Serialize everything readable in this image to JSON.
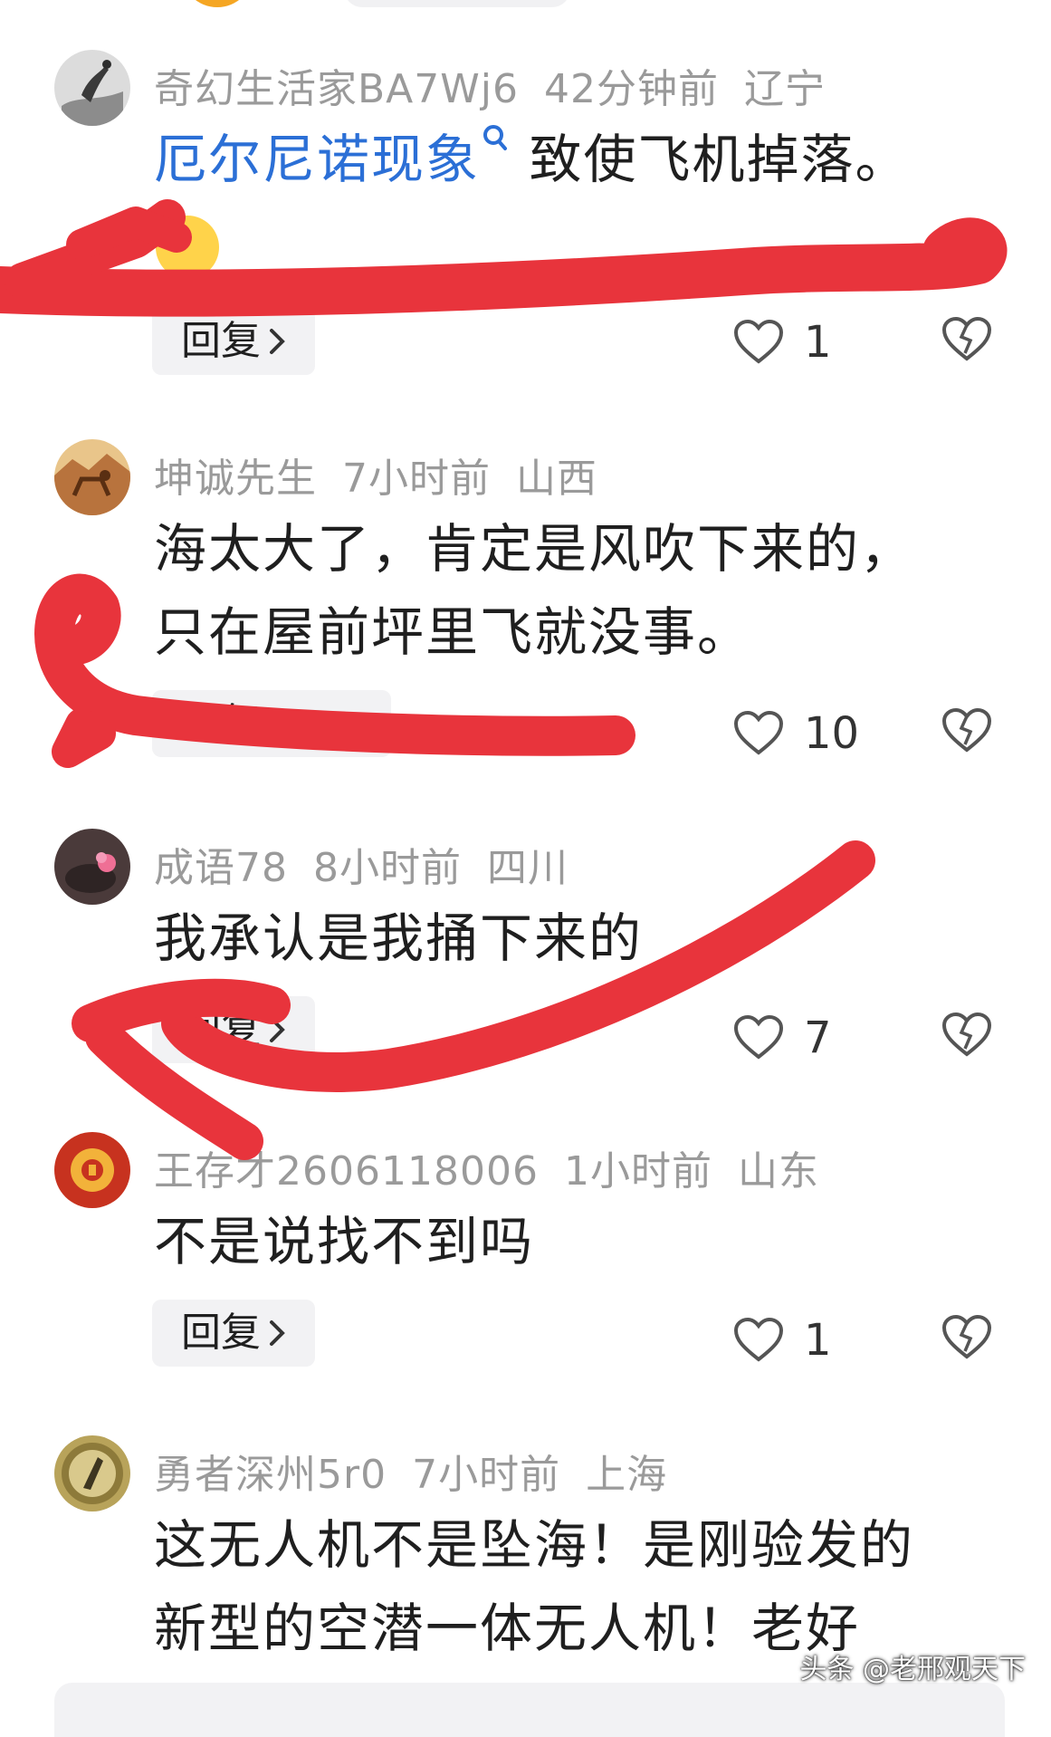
{
  "comments": [
    {
      "user": "奇幻生活家BA7Wj6",
      "time": "42分钟前",
      "location": "辽宁",
      "text_link": "厄尔尼诺现象",
      "text": "致使飞机掉落。",
      "likes": "1"
    },
    {
      "user": "坤诚先生",
      "time": "7小时前",
      "location": "山西",
      "text_line1": "海太大了，肯定是风吹下来的，",
      "text_line2": "只在屋前坪里飞就没事。",
      "likes": "10"
    },
    {
      "user": "成语78",
      "time": "8小时前",
      "location": "四川",
      "text": "我承认是我捅下来的",
      "likes": "7"
    },
    {
      "user": "王存才2606118006",
      "time": "1小时前",
      "location": "山东",
      "text": "不是说找不到吗",
      "likes": "1"
    },
    {
      "user": "勇者深州5r0",
      "time": "7小时前",
      "location": "上海",
      "text_line1": "这无人机不是坠海！是刚验发的",
      "text_line2": "新型的空潜一体无人机！老好"
    }
  ],
  "reply_label": "回复",
  "watermark": "头条 @老邢观天下",
  "icons": {
    "like": "heart-outline-icon",
    "dislike": "broken-heart-icon",
    "search": "search-mini-icon",
    "chevron": "chevron-right-icon"
  },
  "colors": {
    "annotation_red": "#e8343c",
    "link_blue": "#2b6fd6",
    "meta_gray": "#9a9a9a",
    "reply_bg": "#f2f2f4"
  }
}
